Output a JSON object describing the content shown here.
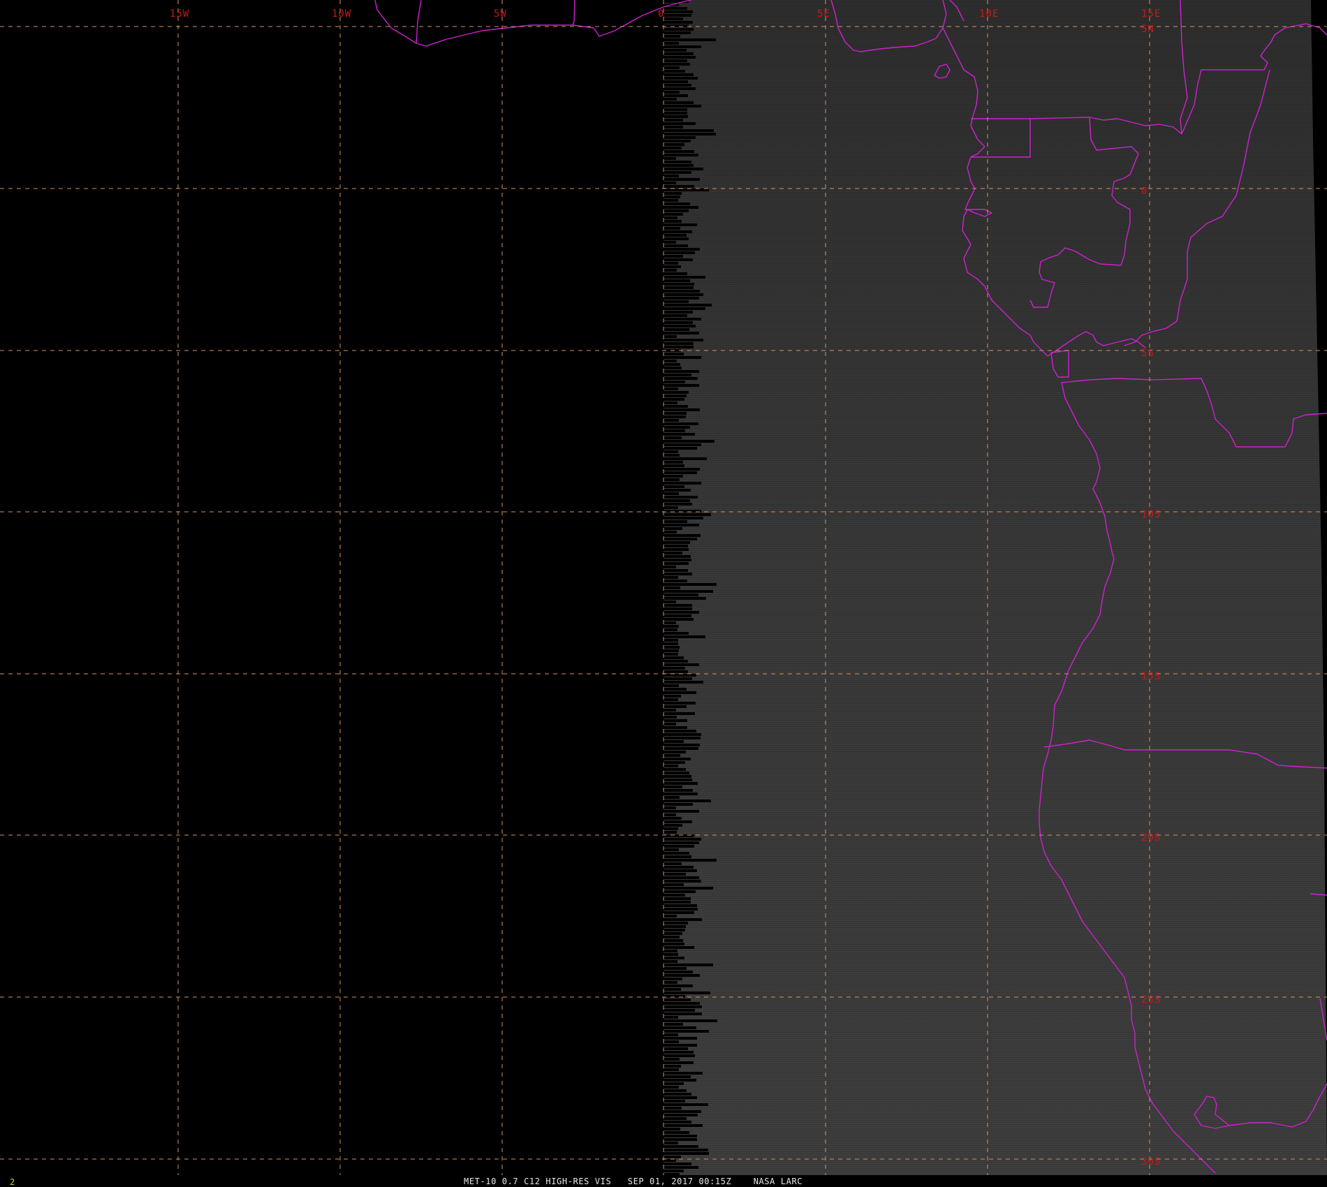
{
  "image": {
    "satellite": "MET-10",
    "product": "0.7 C12 HIGH-RES VIS",
    "datetime": "SEP 01, 2017 00:15Z",
    "source": "NASA LARC",
    "frame": "2"
  },
  "caption": "MET-10 0.7 C12 HIGH-RES VIS   SEP 01, 2017 00:15Z    NASA LARC",
  "grid": {
    "longitude_labels": [
      "15W",
      "10W",
      "5W",
      "0",
      "5E",
      "10E",
      "15E"
    ],
    "latitude_labels": [
      "5N",
      "0",
      "5S",
      "10S",
      "15S",
      "20S",
      "25S",
      "30S"
    ]
  },
  "colors": {
    "background_night": "#000000",
    "background_day": "#3a3a3a",
    "grid_line": "#d89060",
    "grid_label": "#c81818",
    "coastline": "#d020d0",
    "frame_number": "#d6d600",
    "caption": "#e8e8e8"
  }
}
